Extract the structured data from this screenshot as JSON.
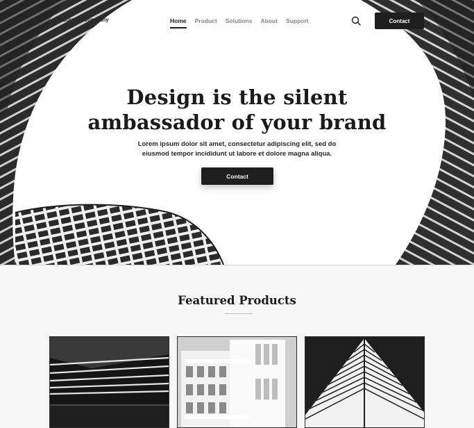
{
  "header": {
    "brand": "Startup Company",
    "nav": [
      {
        "label": "Home",
        "active": true
      },
      {
        "label": "Product",
        "active": false
      },
      {
        "label": "Solutions",
        "active": false
      },
      {
        "label": "About",
        "active": false
      },
      {
        "label": "Support",
        "active": false
      }
    ],
    "search_icon": "search-icon",
    "contact_label": "Contact"
  },
  "hero": {
    "title_line1": "Design is the silent",
    "title_line2": "ambassador of your brand",
    "subtitle_line1": "Lorem ipsum dolor sit amet, consectetur adipiscing elit, sed do",
    "subtitle_line2": "eiusmod tempor incididunt ut labore et dolore magna aliqua.",
    "cta_label": "Contact"
  },
  "featured": {
    "title": "Featured Products",
    "cards": [
      {
        "image": "dark-architecture-stripes"
      },
      {
        "image": "white-modern-building"
      },
      {
        "image": "triangular-skyscraper"
      }
    ]
  },
  "colors": {
    "primary_button": "#1e1e1e",
    "text": "#1b1b1b",
    "muted_nav": "#858585",
    "section_bg": "#f7f7f7"
  }
}
